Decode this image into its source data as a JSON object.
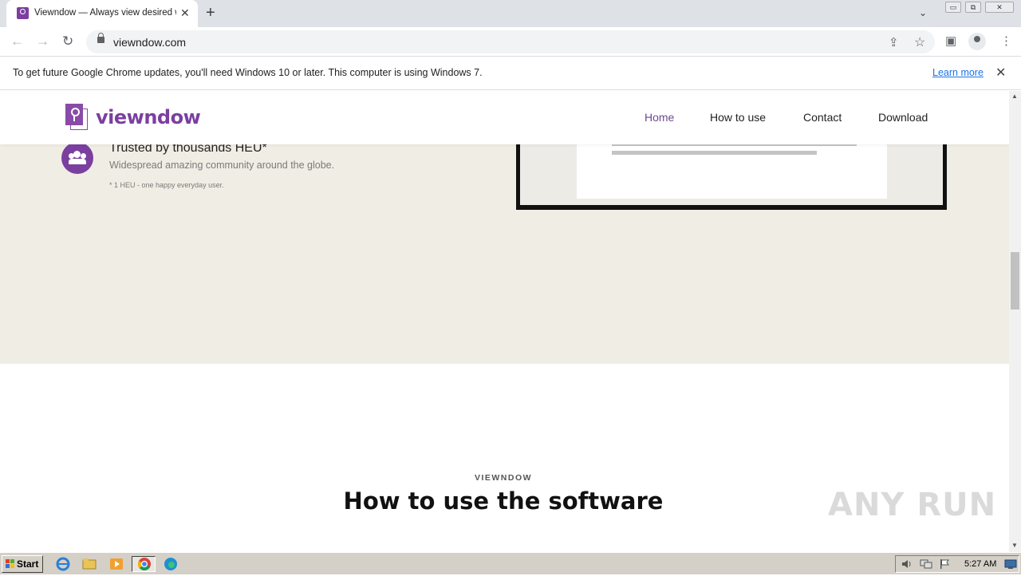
{
  "browser": {
    "tab": {
      "title": "Viewndow — Always view desired w",
      "close": "✕"
    },
    "new_tab": "+",
    "tab_search": "⌄",
    "window_controls": {
      "minimize": "▭",
      "restore": "⧉",
      "close": "✕"
    },
    "nav": {
      "back": "←",
      "forward": "→",
      "reload": "↻"
    },
    "url": "viewndow.com",
    "toolbar_icons": {
      "share": "⇪",
      "bookmark": "☆",
      "side_panel": "▣",
      "menu": "⋮"
    },
    "infobar": {
      "message": "To get future Google Chrome updates, you'll need Windows 10 or later. This computer is using Windows 7.",
      "learn_more": "Learn more",
      "close": "✕"
    }
  },
  "site": {
    "logo_text": "viewndow",
    "nav": [
      {
        "label": "Home",
        "active": true
      },
      {
        "label": "How to use",
        "active": false
      },
      {
        "label": "Contact",
        "active": false
      },
      {
        "label": "Download",
        "active": false
      }
    ],
    "feature": {
      "icon": "users-icon",
      "title": "Trusted by thousands HEU*",
      "description": "Widespread amazing community around the globe.",
      "note": "* 1 HEU - one happy everyday user."
    },
    "section": {
      "kicker": "VIEWNDOW",
      "title": "How to use the software"
    },
    "watermark": "ANY RUN",
    "colors": {
      "brand": "#7b3fa0",
      "hero_bg": "#f0ede4"
    }
  },
  "scrollbar": {
    "up": "▲",
    "down": "▼"
  },
  "taskbar": {
    "start_label": "Start",
    "apps": [
      "internet-explorer-icon",
      "file-explorer-icon",
      "media-player-icon",
      "chrome-icon",
      "edge-icon"
    ],
    "clock": "5:27 AM"
  }
}
